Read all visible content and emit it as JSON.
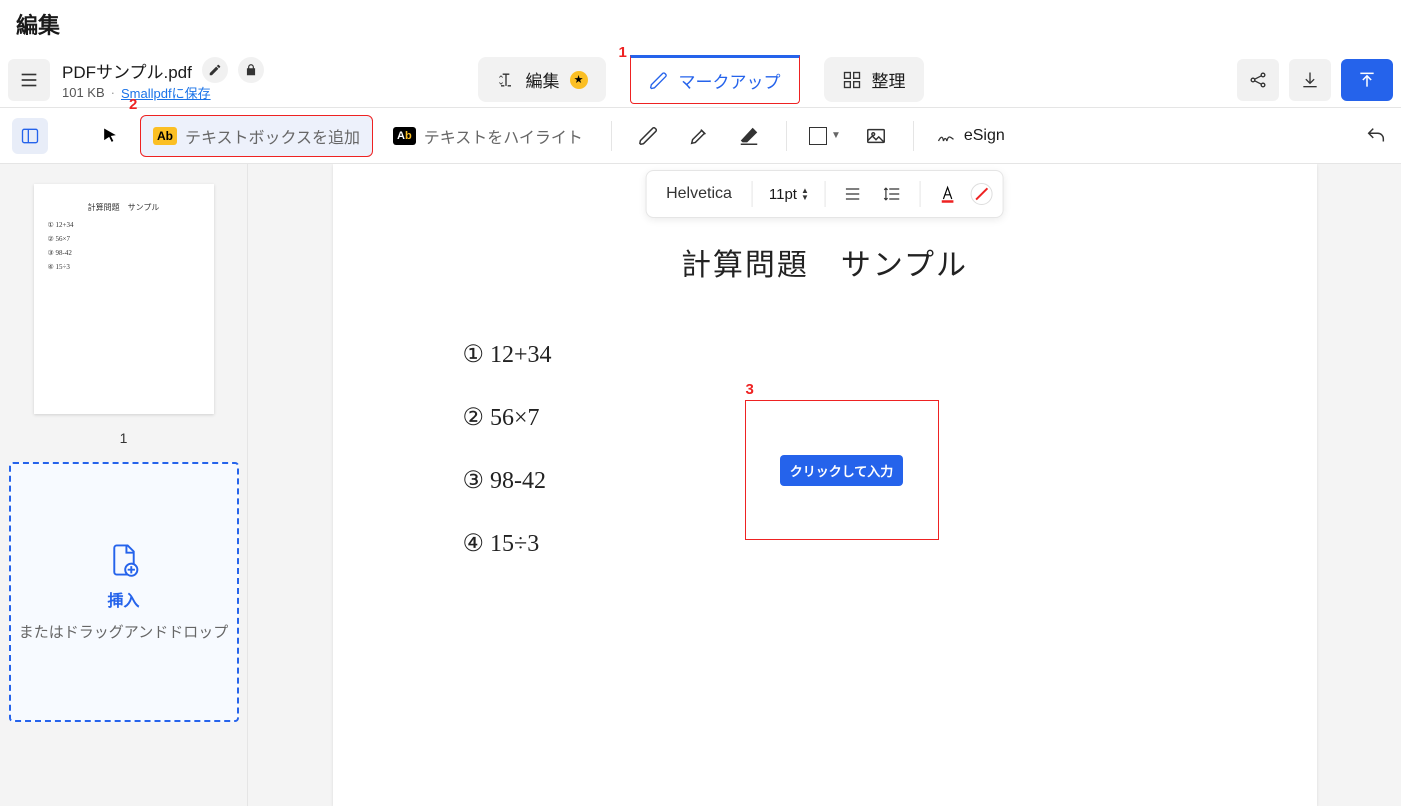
{
  "heading": "編集",
  "file": {
    "name": "PDFサンプル.pdf",
    "size": "101 KB",
    "save_link": "Smallpdfに保存"
  },
  "modes": {
    "edit": "編集",
    "markup": "マークアップ",
    "organize": "整理"
  },
  "callouts": {
    "c1": "1",
    "c2": "2",
    "c3": "3"
  },
  "tools": {
    "add_textbox": "テキストボックスを追加",
    "add_textbox_badge": "Ab",
    "highlight": "テキストをハイライト",
    "esign": "eSign"
  },
  "floatbar": {
    "font": "Helvetica",
    "size": "11pt"
  },
  "document": {
    "title": "計算問題　サンプル",
    "problems": [
      "① 12+34",
      "② 56×7",
      "③ 98-42",
      "④ 15÷3"
    ]
  },
  "textbox_placeholder": "クリックして入力",
  "sidebar": {
    "page_number": "1",
    "insert_title": "挿入",
    "insert_sub": "またはドラッグアンドドロップ"
  },
  "thumb": {
    "title": "計算問題　サンプル",
    "lines": [
      "① 12+34",
      "② 56×7",
      "③ 98-42",
      "④ 15÷3"
    ]
  }
}
